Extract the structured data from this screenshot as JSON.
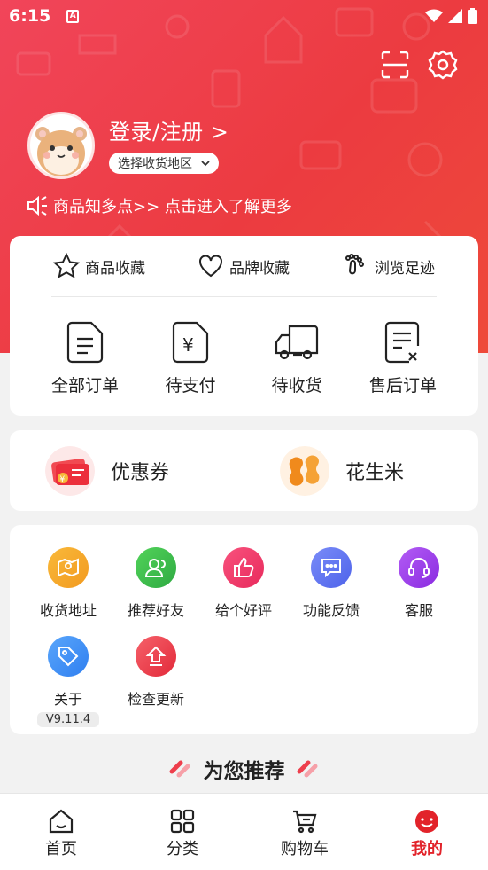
{
  "status_bar": {
    "time": "6:15",
    "sim_label": "A"
  },
  "profile": {
    "login_text": "登录/注册 >",
    "region_chip": "选择收货地区",
    "notice": "商品知多点>> 点击进入了解更多"
  },
  "favorites": [
    {
      "label": "商品收藏",
      "icon": "star-icon"
    },
    {
      "label": "品牌收藏",
      "icon": "heart-icon"
    },
    {
      "label": "浏览足迹",
      "icon": "footprint-icon"
    }
  ],
  "orders": [
    {
      "label": "全部订单",
      "icon": "order-list-icon"
    },
    {
      "label": "待支付",
      "icon": "pending-payment-icon"
    },
    {
      "label": "待收货",
      "icon": "delivery-truck-icon"
    },
    {
      "label": "售后订单",
      "icon": "after-sales-icon"
    }
  ],
  "assets": [
    {
      "label": "优惠券",
      "icon": "coupon-icon"
    },
    {
      "label": "花生米",
      "icon": "peanut-icon"
    }
  ],
  "services": [
    {
      "label": "收货地址",
      "icon": "address-map-icon",
      "color": "#f6a623"
    },
    {
      "label": "推荐好友",
      "icon": "invite-friend-icon",
      "color": "#3cc04e"
    },
    {
      "label": "给个好评",
      "icon": "thumbs-up-icon",
      "color": "#f0336b"
    },
    {
      "label": "功能反馈",
      "icon": "feedback-icon",
      "color": "#6477f2"
    },
    {
      "label": "客服",
      "icon": "headset-icon",
      "color": "#9b3ef0"
    },
    {
      "label": "关于",
      "icon": "tag-icon",
      "color": "#3d8ef5"
    },
    {
      "label": "检查更新",
      "icon": "upload-icon",
      "color": "#ee3e4c"
    }
  ],
  "version": "V9.11.4",
  "recommend_title": "为您推荐",
  "tabs": [
    {
      "label": "首页",
      "icon": "home-icon",
      "active": false
    },
    {
      "label": "分类",
      "icon": "category-grid-icon",
      "active": false
    },
    {
      "label": "购物车",
      "icon": "cart-icon",
      "active": false
    },
    {
      "label": "我的",
      "icon": "profile-icon",
      "active": true
    }
  ],
  "colors": {
    "brand_red": "#ec3b40",
    "active_tab": "#e2232a"
  }
}
